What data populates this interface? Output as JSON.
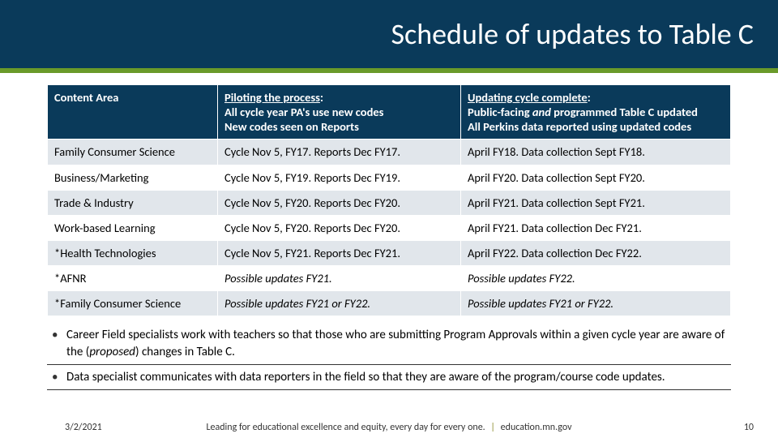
{
  "title": "Schedule of updates to Table C",
  "table": {
    "headers": {
      "col1": "Content Area",
      "col2_u": "Piloting the process",
      "col2_l1": "All cycle year PA's use new codes",
      "col2_l2": "New codes seen on Reports",
      "col3_u": "Updating cycle complete",
      "col3_l1_a": "Public-facing ",
      "col3_l1_b": "and",
      "col3_l1_c": " programmed Table C updated",
      "col3_l2": "All Perkins data reported using updated codes"
    },
    "rows": [
      {
        "c1": "Family Consumer Science",
        "c2": "Cycle Nov 5, FY17. Reports Dec FY17.",
        "c3": "April FY18. Data collection Sept FY18.",
        "italic": false
      },
      {
        "c1": "Business/Marketing",
        "c2": "Cycle Nov 5, FY19. Reports Dec FY19.",
        "c3": "April FY20. Data collection Sept FY20.",
        "italic": false
      },
      {
        "c1": "Trade & Industry",
        "c2": "Cycle Nov 5, FY20. Reports Dec FY20.",
        "c3": "April FY21. Data collection Sept FY21.",
        "italic": false
      },
      {
        "c1": "Work-based Learning",
        "c2": "Cycle Nov 5, FY20. Reports Dec FY20.",
        "c3": "April FY21. Data collection  Dec FY21.",
        "italic": false
      },
      {
        "c1": "*Health Technologies",
        "c2": "Cycle Nov 5, FY21. Reports Dec FY21.",
        "c3": "April FY22. Data collection  Dec FY22.",
        "italic": false
      },
      {
        "c1": "*AFNR",
        "c2": "Possible updates FY21.",
        "c3": "Possible updates FY22.",
        "italic": true
      },
      {
        "c1": "*Family Consumer Science",
        "c2": "Possible updates FY21 or FY22.",
        "c3": "Possible updates FY21 or FY22.",
        "italic": true
      }
    ]
  },
  "bullets": [
    {
      "pre": "Career Field specialists work with teachers so that those who are submitting Program Approvals within a given cycle year are aware of the (",
      "ital": "proposed",
      "post": ") changes in Table C."
    },
    {
      "pre": "Data specialist communicates with data reporters in the field so that they are aware of the program/course code updates.",
      "ital": "",
      "post": ""
    }
  ],
  "footer": {
    "date": "3/2/2021",
    "center_a": "Leading for educational excellence and equity, every day for every one.",
    "sep": "|",
    "center_b": "education.mn.gov",
    "page": "10"
  }
}
